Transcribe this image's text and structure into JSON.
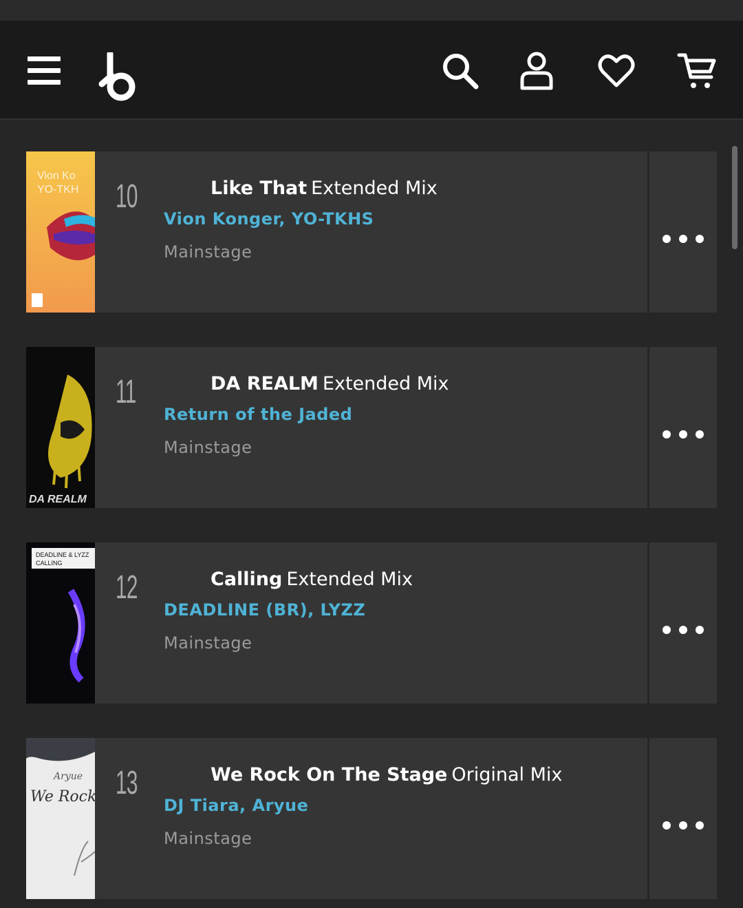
{
  "header": {
    "menu_icon": "hamburger-menu-icon",
    "logo_icon": "beatport-logo-icon",
    "search_icon": "search-icon",
    "account_icon": "account-icon",
    "wishlist_icon": "heart-icon",
    "cart_icon": "cart-icon"
  },
  "tracks": [
    {
      "rank": "10",
      "title": "Like That",
      "mix": "Extended Mix",
      "artists": "Vion Konger, YO-TKHS",
      "label": "Mainstage",
      "art_text": "Vion Ko\nYO-TKH",
      "more_icon": "more-options-icon"
    },
    {
      "rank": "11",
      "title": "DA REALM",
      "mix": "Extended Mix",
      "artists": "Return of the Jaded",
      "label": "Mainstage",
      "art_text": "DA REALM",
      "more_icon": "more-options-icon"
    },
    {
      "rank": "12",
      "title": "Calling",
      "mix": "Extended Mix",
      "artists": "DEADLINE (BR), LYZZ",
      "label": "Mainstage",
      "art_text": "DEADLINE & LYZZ CALLING",
      "more_icon": "more-options-icon"
    },
    {
      "rank": "13",
      "title": "We Rock On The Stage",
      "mix": "Original Mix",
      "artists": "DJ Tiara, Aryue",
      "label": "Mainstage",
      "art_text": "Aryue We Rock",
      "more_icon": "more-options-icon"
    }
  ],
  "colors": {
    "artist": "#4fb3d6",
    "card": "#353535",
    "header": "#1a1a1a",
    "background": "#262626"
  }
}
